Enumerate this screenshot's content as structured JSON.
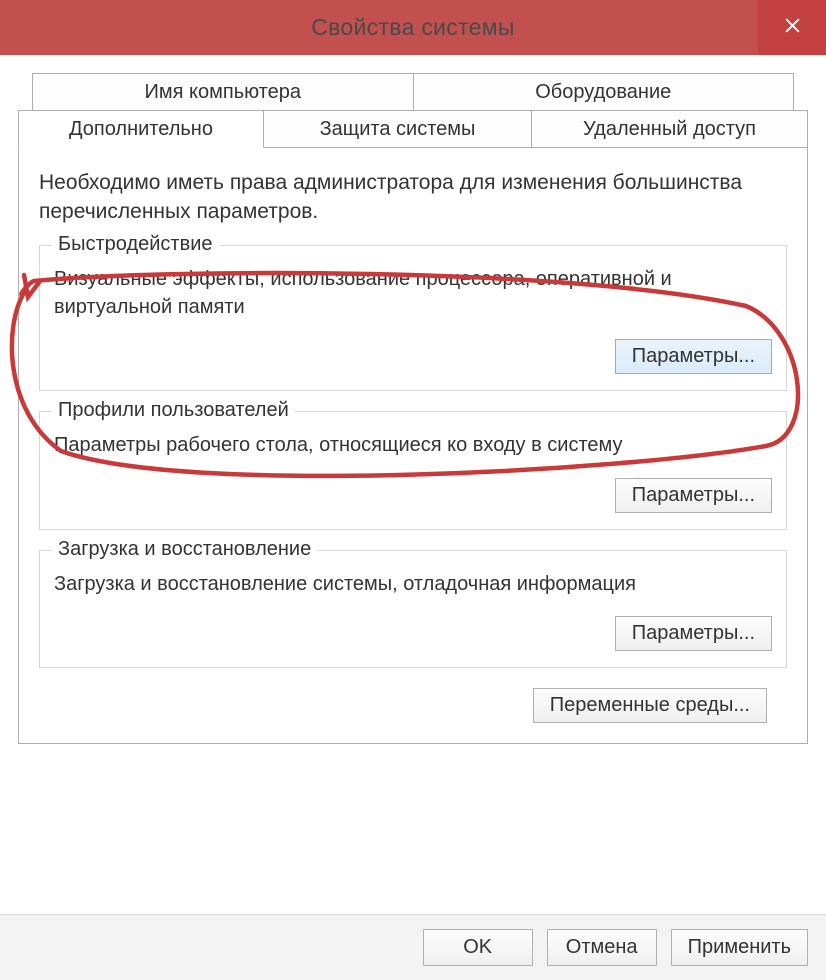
{
  "titlebar": {
    "title": "Свойства системы"
  },
  "tabs": {
    "row1": [
      {
        "label": "Имя компьютера"
      },
      {
        "label": "Оборудование"
      }
    ],
    "row2": [
      {
        "label": "Дополнительно",
        "active": true
      },
      {
        "label": "Защита системы"
      },
      {
        "label": "Удаленный доступ"
      }
    ]
  },
  "panel": {
    "intro": "Необходимо иметь права администратора для изменения большинства перечисленных параметров."
  },
  "groups": {
    "performance": {
      "legend": "Быстродействие",
      "desc": "Визуальные эффекты, использование процессора, оперативной и виртуальной памяти",
      "button": "Параметры..."
    },
    "profiles": {
      "legend": "Профили пользователей",
      "desc": "Параметры рабочего стола, относящиеся ко входу в систему",
      "button": "Параметры..."
    },
    "startup": {
      "legend": "Загрузка и восстановление",
      "desc": "Загрузка и восстановление системы, отладочная информация",
      "button": "Параметры..."
    }
  },
  "env_button": "Переменные среды...",
  "footer": {
    "ok": "OK",
    "cancel": "Отмена",
    "apply": "Применить"
  }
}
